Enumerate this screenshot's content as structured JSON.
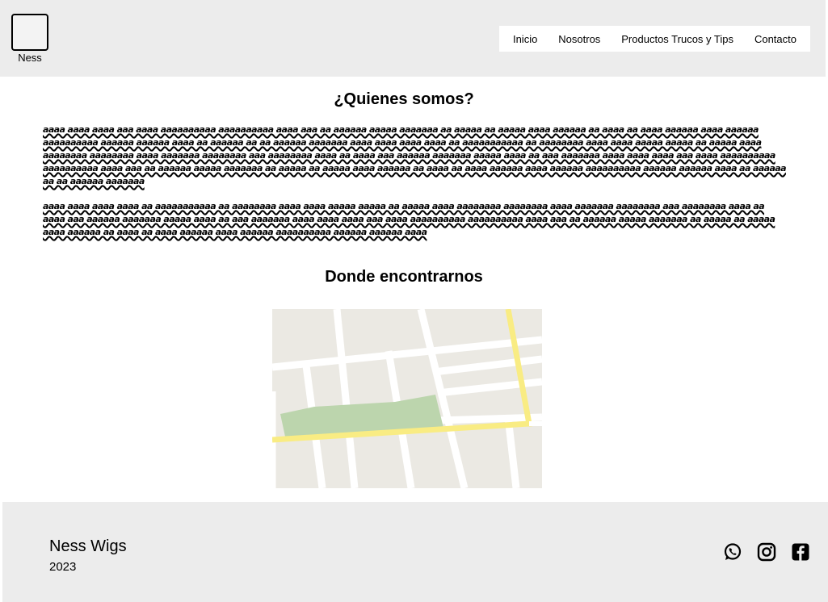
{
  "header": {
    "logo_text": "Ness",
    "nav": [
      "Inicio",
      "Nosotros",
      "Productos Trucos y Tips",
      "Contacto"
    ]
  },
  "about": {
    "title": "¿Quienes somos?",
    "paragraph1": "aaaa aaaa aaaa aaa aaaa aaaaaaaaaa aaaaaaaaaa aaaa aaa aa aaaaaa aaaaa aaaaaaa aa aaaaa aa aaaaa aaaa aaaaaa aa aaaa aa aaaa aaaaaa aaaa aaaaaa aaaaaaaaaa aaaaaa aaaaaa aaaa aa aaaaaa aa aa aaaaaa aaaaaaa aaaa aaaa aaaa aaaa aa aaaaaaaaaaa aa aaaaaaaa aaaa aaaa aaaaa aaaaa aa aaaaa aaaa aaaaaaaa aaaaaaaa aaaa aaaaaaa aaaaaaaa aaa aaaaaaaa aaaa aa aaaa aaa aaaaaa aaaaaaa aaaaa aaaa aa aaa aaaaaaa aaaa aaaa aaaa aaa aaaa aaaaaaaaaa aaaaaaaaaa aaaa aaa aa aaaaaa aaaaa aaaaaaa aa aaaaa aa aaaaa aaaa aaaaaa aa aaaa aa aaaa aaaaaa aaaa aaaaaa aaaaaaaaaa aaaaaa aaaaaa aaaa aa aaaaaa aa aa aaaaaa aaaaaaa",
    "paragraph2": "aaaa aaaa aaaa aaaa aa aaaaaaaaaaa aa aaaaaaaa aaaa aaaa aaaaa aaaaa aa aaaaa aaaa aaaaaaaa aaaaaaaa aaaa aaaaaaa aaaaaaaa aaa aaaaaaaa aaaa aa aaaa aaa aaaaaa aaaaaaa aaaaa aaaa aa aaa aaaaaaa aaaa aaaa aaaa aaa aaaa aaaaaaaaaa aaaaaaaaaa aaaa aaa aa aaaaaa aaaaa aaaaaaa aa aaaaa aa aaaaa aaaa aaaaaa aa aaaa aa aaaa aaaaaa aaaa aaaaaa aaaaaaaaaa aaaaaa aaaaaa aaaa"
  },
  "location": {
    "title": "Donde encontrarnos"
  },
  "footer": {
    "brand": "Ness Wigs",
    "year": "2023",
    "icons": [
      "whatsapp-icon",
      "instagram-icon",
      "facebook-icon"
    ]
  },
  "colors": {
    "header_bg": "#ececec",
    "map_road_major": "#f9ec83",
    "map_park": "#bcd5ad"
  }
}
